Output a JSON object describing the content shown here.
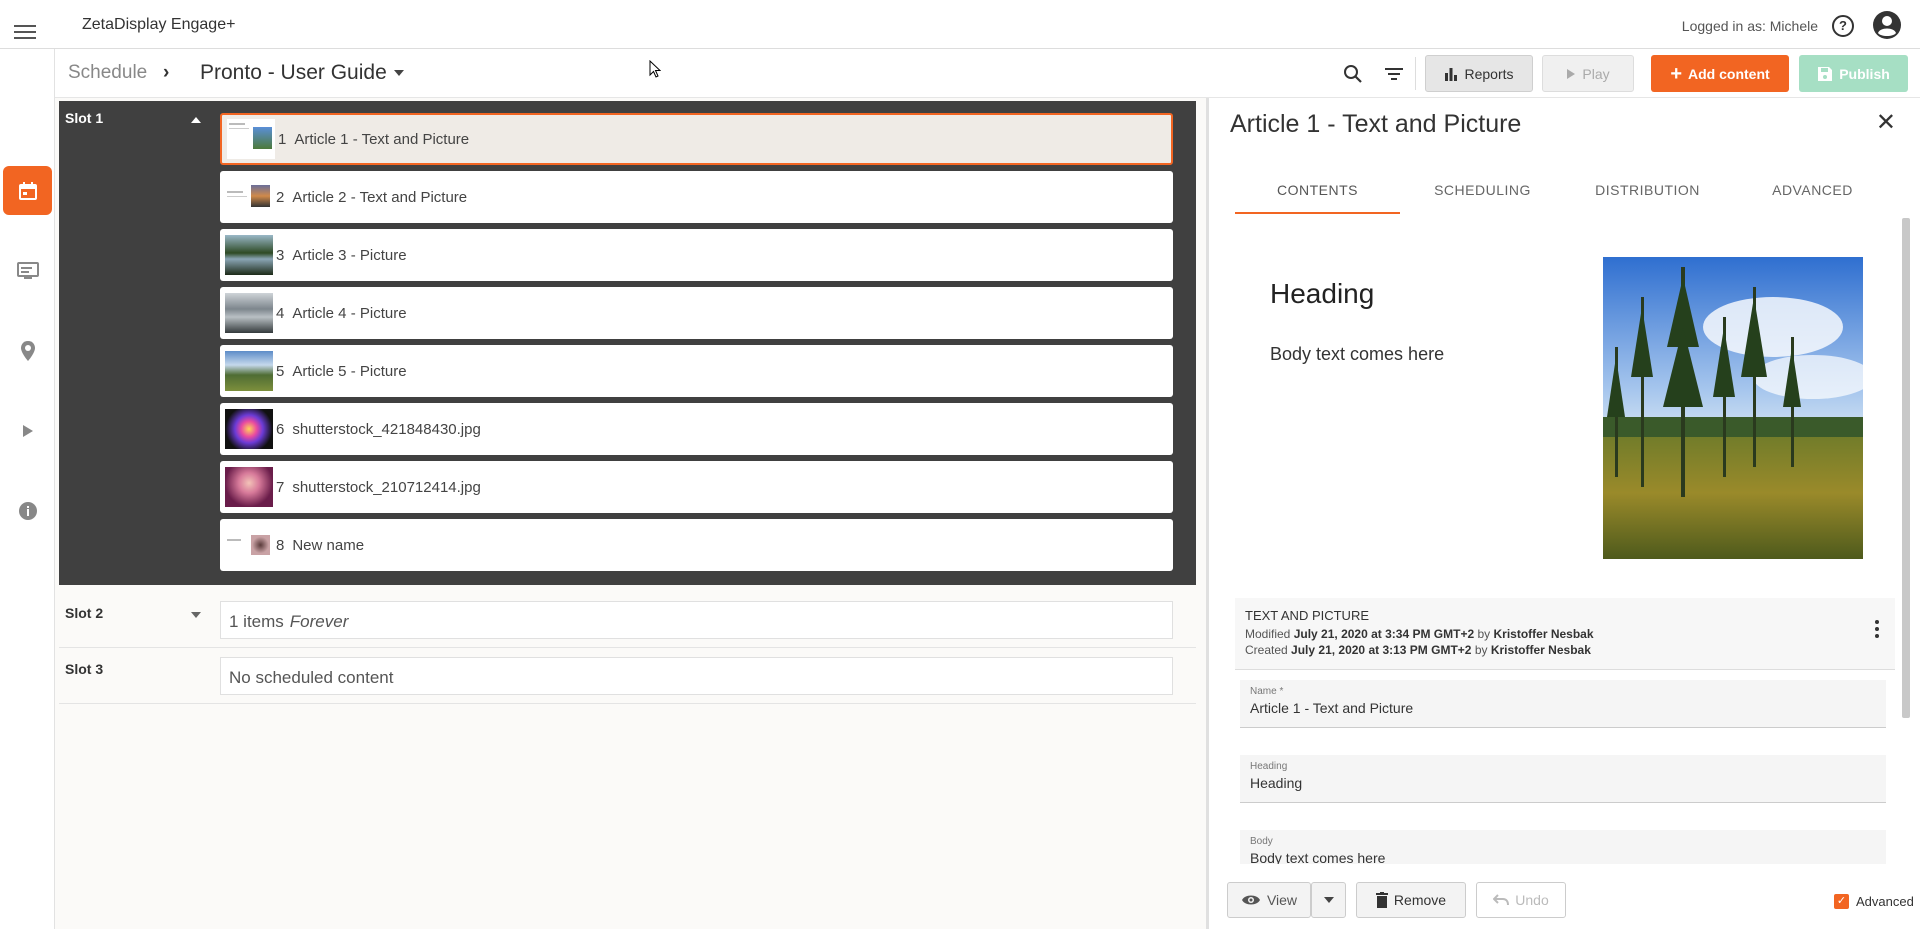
{
  "app": {
    "title": "ZetaDisplay Engage+",
    "logged_in": "Logged in as: Michele"
  },
  "breadcrumb": {
    "root": "Schedule",
    "separator": "»",
    "current": "Pronto - User Guide"
  },
  "toolbar": {
    "reports": "Reports",
    "play": "Play",
    "add_content": "Add content",
    "publish": "Publish"
  },
  "rail": [
    "calendar-icon",
    "display-icon",
    "location-icon",
    "play-icon",
    "info-icon"
  ],
  "slots": [
    {
      "label": "Slot 1",
      "expanded": true,
      "items": [
        {
          "num": "1",
          "name": "Article 1 - Text and Picture",
          "selected": true
        },
        {
          "num": "2",
          "name": "Article 2 - Text and Picture"
        },
        {
          "num": "3",
          "name": "Article 3 - Picture"
        },
        {
          "num": "4",
          "name": "Article 4 - Picture"
        },
        {
          "num": "5",
          "name": "Article 5 - Picture"
        },
        {
          "num": "6",
          "name": "shutterstock_421848430.jpg"
        },
        {
          "num": "7",
          "name": "shutterstock_210712414.jpg"
        },
        {
          "num": "8",
          "name": "New name"
        }
      ]
    },
    {
      "label": "Slot 2",
      "summary": "1 items",
      "summary_em": "Forever"
    },
    {
      "label": "Slot 3",
      "summary": "No scheduled content"
    }
  ],
  "detail": {
    "title": "Article 1 - Text and Picture",
    "tabs": [
      "CONTENTS",
      "SCHEDULING",
      "DISTRIBUTION",
      "ADVANCED"
    ],
    "preview": {
      "heading": "Heading",
      "body": "Body text comes here"
    },
    "meta": {
      "type": "TEXT AND PICTURE",
      "modified_prefix": "Modified",
      "modified_date": "July 21, 2020 at 3:34 PM GMT+2",
      "modified_by_prefix": "by",
      "modified_by": "Kristoffer Nesbak",
      "created_prefix": "Created",
      "created_date": "July 21, 2020 at 3:13 PM GMT+2",
      "created_by_prefix": "by",
      "created_by": "Kristoffer Nesbak"
    },
    "fields": [
      {
        "label": "Name *",
        "value": "Article 1 - Text and Picture"
      },
      {
        "label": "Heading",
        "value": "Heading"
      },
      {
        "label": "Body",
        "value": "Body text comes here"
      }
    ],
    "actions": {
      "view": "View",
      "remove": "Remove",
      "undo": "Undo",
      "advanced": "Advanced",
      "advanced_checked": true
    }
  },
  "colors": {
    "accent": "#f26522",
    "publish_disabled": "#a6dfc4",
    "slot_bg": "#404040"
  }
}
